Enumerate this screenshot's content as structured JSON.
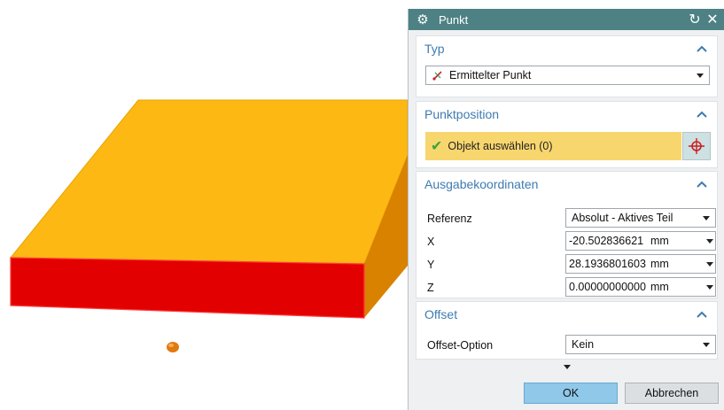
{
  "dialog": {
    "title": "Punkt",
    "title_icon": "gear-icon",
    "reset_icon": "reset-icon",
    "close_icon": "close-icon"
  },
  "sections": {
    "typ": {
      "header": "Typ",
      "select_value": "Ermittelter Punkt",
      "select_icon": "inferred-point-icon"
    },
    "punktposition": {
      "header": "Punktposition",
      "select_object_label": "Objekt auswählen (0)",
      "point_dialog_icon": "crosshair-icon"
    },
    "ausgabekoordinaten": {
      "header": "Ausgabekoordinaten",
      "referenz_label": "Referenz",
      "referenz_value": "Absolut - Aktives Teil",
      "coords": [
        {
          "label": "X",
          "value": "-20.502836621",
          "unit": "mm"
        },
        {
          "label": "Y",
          "value": "28.1936801603",
          "unit": "mm"
        },
        {
          "label": "Z",
          "value": "0.00000000000",
          "unit": "mm"
        }
      ]
    },
    "offset": {
      "header": "Offset",
      "option_label": "Offset-Option",
      "option_value": "Kein"
    }
  },
  "buttons": {
    "ok": "OK",
    "cancel": "Abbrechen"
  },
  "colors": {
    "titlebar": "#4d8184",
    "section_header_text": "#3e7bb0",
    "selection_highlight": "#f8d66e",
    "box_top": "#fdb813",
    "box_front": "#e30000",
    "box_side": "#d98200",
    "point_marker": "#e07a10",
    "ok_button": "#8fc8e8"
  }
}
